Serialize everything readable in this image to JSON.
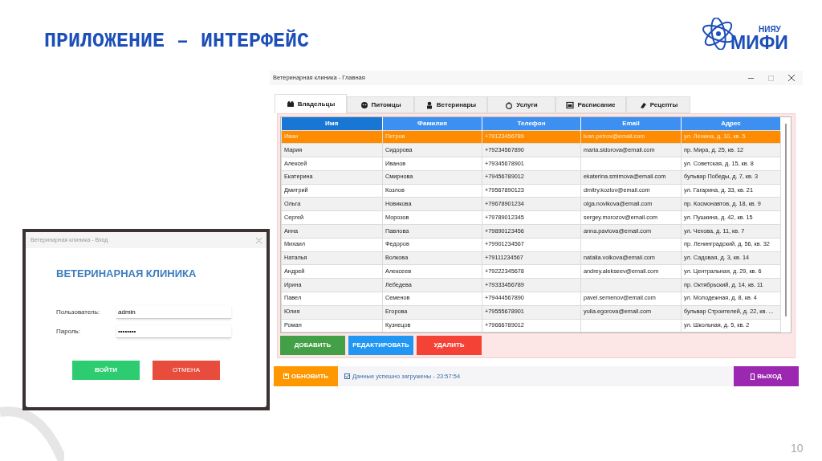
{
  "slide": {
    "title": "ПРИЛОЖЕНИЕ – ИНТЕРФЕЙС",
    "logo": {
      "abbr": "НИЯУ",
      "name": "МИФИ"
    },
    "page_number": "10"
  },
  "login_window": {
    "title": "Ветеринарная клиника - Вход",
    "heading": "ВЕТЕРИНАРНАЯ КЛИНИКА",
    "fields": [
      {
        "label": "Пользователь:",
        "value": "admin"
      },
      {
        "label": "Пароль:",
        "value": "••••••••"
      }
    ],
    "buttons": [
      {
        "label": "ВОЙТИ",
        "kind": "confirm"
      },
      {
        "label": "ОТМЕНА",
        "kind": "cancel"
      }
    ]
  },
  "main_window": {
    "title": "Ветеринарная клиника - Главная",
    "tabs": [
      {
        "label": "Владельцы",
        "selected": true
      },
      {
        "label": "Питомцы",
        "selected": false
      },
      {
        "label": "Ветеринары",
        "selected": false
      },
      {
        "label": "Услуги",
        "selected": false
      },
      {
        "label": "Расписание",
        "selected": false
      },
      {
        "label": "Рецепты",
        "selected": false
      }
    ],
    "table": {
      "columns": [
        "Имя",
        "Фамилия",
        "Телефон",
        "Email",
        "Адрес"
      ],
      "rows": [
        {
          "cells": [
            "Иван",
            "Петров",
            "+79123456789",
            "ivan.petrov@email.com",
            "ул. Ленина, д. 10, кв. 5"
          ],
          "selected": true
        },
        {
          "cells": [
            "Мария",
            "Сидорова",
            "+79234567890",
            "maria.sidorova@email.com",
            "пр. Мира, д. 25, кв. 12"
          ],
          "selected": false
        },
        {
          "cells": [
            "Алексей",
            "Иванов",
            "+79345678901",
            null,
            "ул. Советская, д. 15, кв. 8"
          ],
          "selected": false
        },
        {
          "cells": [
            "Екатерина",
            "Смирнова",
            "+79456789012",
            "ekaterina.smirnova@email.com",
            "бульвар Победы, д. 7, кв. 3"
          ],
          "selected": false
        },
        {
          "cells": [
            "Дмитрий",
            "Козлов",
            "+79567890123",
            "dmitry.kozlov@email.com",
            "ул. Гагарина, д. 33, кв. 21"
          ],
          "selected": false
        },
        {
          "cells": [
            "Ольга",
            "Новикова",
            "+79678901234",
            "olga.novikova@email.com",
            "пр. Космонавтов, д. 18, кв. 9"
          ],
          "selected": false
        },
        {
          "cells": [
            "Сергей",
            "Морозов",
            "+79789012345",
            "sergey.morozov@email.com",
            "ул. Пушкина, д. 42, кв. 15"
          ],
          "selected": false
        },
        {
          "cells": [
            "Анна",
            "Павлова",
            "+79890123456",
            "anna.pavlova@email.com",
            "ул. Чехова, д. 11, кв. 7"
          ],
          "selected": false
        },
        {
          "cells": [
            "Михаил",
            "Федоров",
            "+79901234567",
            null,
            "пр. Ленинградский, д. 56, кв. 32"
          ],
          "selected": false
        },
        {
          "cells": [
            "Наталья",
            "Волкова",
            "+79111234567",
            "natalia.volkova@email.com",
            "ул. Садовая, д. 3, кв. 14"
          ],
          "selected": false
        },
        {
          "cells": [
            "Андрей",
            "Алексеев",
            "+79222345678",
            "andrey.alekseev@email.com",
            "ул. Центральная, д. 29, кв. 6"
          ],
          "selected": false
        },
        {
          "cells": [
            "Ирина",
            "Лебедева",
            "+79333456789",
            null,
            "пр. Октябрьский, д. 14, кв. 11"
          ],
          "selected": false
        },
        {
          "cells": [
            "Павел",
            "Семенов",
            "+79444567890",
            "pavel.semenov@email.com",
            "ул. Молодежная, д. 8, кв. 4"
          ],
          "selected": false
        },
        {
          "cells": [
            "Юлия",
            "Егорова",
            "+79555678901",
            "yulia.egorova@email.com",
            "бульвар Строителей, д. 22, кв. ..."
          ],
          "selected": false
        },
        {
          "cells": [
            "Роман",
            "Кузнецов",
            "+79666789012",
            null,
            "ул. Школьная, д. 5, кв. 2"
          ],
          "selected": false
        }
      ]
    },
    "actions": [
      {
        "label": "ДОБАВИТЬ",
        "kind": "add"
      },
      {
        "label": "РЕДАКТИРОВАТЬ",
        "kind": "edit"
      },
      {
        "label": "УДАЛИТЬ",
        "kind": "delete"
      }
    ],
    "refresh_button": "ОБНОВИТЬ",
    "status": "Данные успешно загружены - 23:57:54",
    "exit_button": "ВЫХОД"
  }
}
